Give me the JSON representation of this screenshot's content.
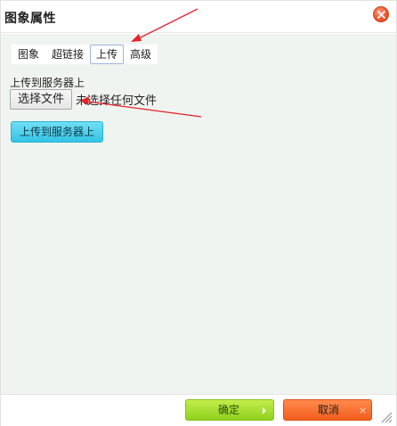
{
  "dialog": {
    "title": "图象属性"
  },
  "tabs": [
    {
      "label": "图象",
      "active": false
    },
    {
      "label": "超链接",
      "active": false
    },
    {
      "label": "上传",
      "active": true
    },
    {
      "label": "高级",
      "active": false
    }
  ],
  "upload": {
    "section_label": "上传到服务器上",
    "choose_file_label": "选择文件",
    "no_file_text": "未选择任何文件",
    "upload_button_label": "上传到服务器上"
  },
  "footer": {
    "ok_label": "确定",
    "cancel_label": "取消",
    "cancel_icon": "×"
  },
  "colors": {
    "annotation_arrow": "#e3242b",
    "ok_button": "#9fd92a",
    "cancel_button": "#f56a2a",
    "upload_button": "#3fcbeb",
    "content_bg": "#f0f4f0"
  },
  "icons": {
    "close": "close-icon",
    "ok_arrow": "play-arrow-icon",
    "cancel_x": "close-icon",
    "resize": "resize-grip-icon"
  }
}
